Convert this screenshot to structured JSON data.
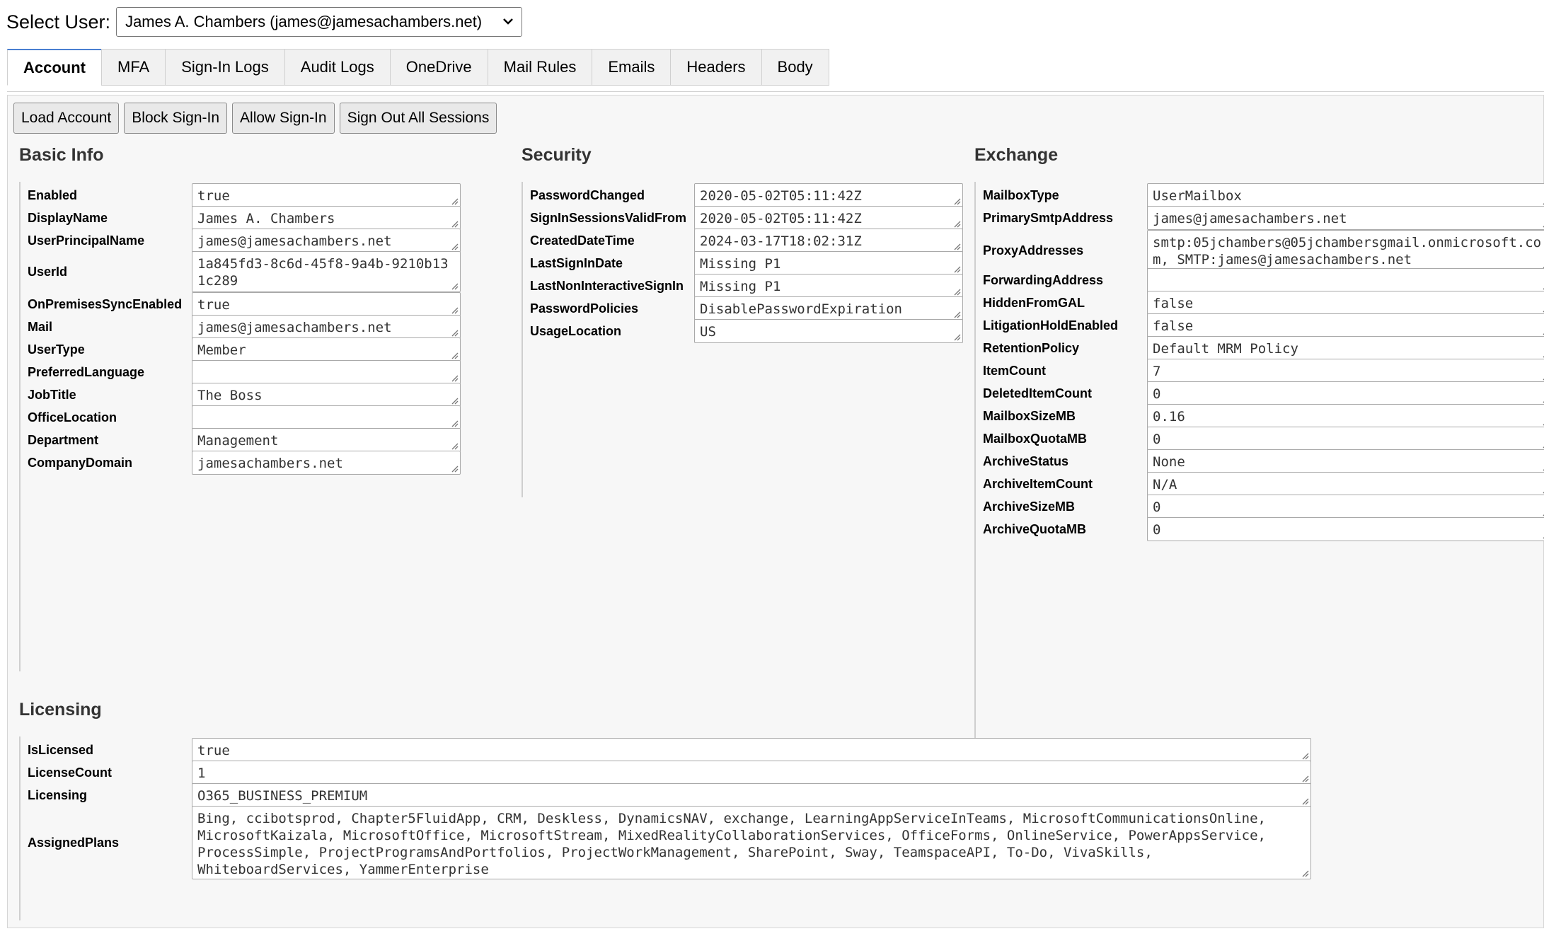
{
  "user_select": {
    "label": "Select User:",
    "selected": "James A. Chambers (james@jamesachambers.net)"
  },
  "tabs": [
    {
      "label": "Account",
      "active": true
    },
    {
      "label": "MFA"
    },
    {
      "label": "Sign-In Logs"
    },
    {
      "label": "Audit Logs"
    },
    {
      "label": "OneDrive"
    },
    {
      "label": "Mail Rules"
    },
    {
      "label": "Emails"
    },
    {
      "label": "Headers"
    },
    {
      "label": "Body"
    }
  ],
  "actions": {
    "load": "Load Account",
    "block": "Block Sign-In",
    "allow": "Allow Sign-In",
    "signout": "Sign Out All Sessions"
  },
  "basic_info": {
    "title": "Basic Info",
    "fields": [
      {
        "key": "Enabled",
        "value": "true"
      },
      {
        "key": "DisplayName",
        "value": "James A. Chambers"
      },
      {
        "key": "UserPrincipalName",
        "value": "james@jamesachambers.net"
      },
      {
        "key": "UserId",
        "value": "1a845fd3-8c6d-45f8-9a4b-9210b131c289"
      },
      {
        "key": "OnPremisesSyncEnabled",
        "value": "true"
      },
      {
        "key": "Mail",
        "value": "james@jamesachambers.net"
      },
      {
        "key": "UserType",
        "value": "Member"
      },
      {
        "key": "PreferredLanguage",
        "value": ""
      },
      {
        "key": "JobTitle",
        "value": "The Boss"
      },
      {
        "key": "OfficeLocation",
        "value": ""
      },
      {
        "key": "Department",
        "value": "Management"
      },
      {
        "key": "CompanyDomain",
        "value": "jamesachambers.net"
      }
    ]
  },
  "security": {
    "title": "Security",
    "fields": [
      {
        "key": "PasswordChanged",
        "value": "2020-05-02T05:11:42Z"
      },
      {
        "key": "SignInSessionsValidFrom",
        "value": "2020-05-02T05:11:42Z"
      },
      {
        "key": "CreatedDateTime",
        "value": "2024-03-17T18:02:31Z"
      },
      {
        "key": "LastSignInDate",
        "value": "Missing P1"
      },
      {
        "key": "LastNonInteractiveSignIn",
        "value": "Missing P1"
      },
      {
        "key": "PasswordPolicies",
        "value": "DisablePasswordExpiration"
      },
      {
        "key": "UsageLocation",
        "value": "US"
      }
    ]
  },
  "exchange": {
    "title": "Exchange",
    "fields": [
      {
        "key": "MailboxType",
        "value": "UserMailbox"
      },
      {
        "key": "PrimarySmtpAddress",
        "value": "james@jamesachambers.net"
      },
      {
        "key": "ProxyAddresses",
        "value": "smtp:05jchambers@05jchambersgmail.onmicrosoft.com, SMTP:james@jamesachambers.net"
      },
      {
        "key": "ForwardingAddress",
        "value": ""
      },
      {
        "key": "HiddenFromGAL",
        "value": "false"
      },
      {
        "key": "LitigationHoldEnabled",
        "value": "false"
      },
      {
        "key": "RetentionPolicy",
        "value": "Default MRM Policy"
      },
      {
        "key": "ItemCount",
        "value": "7"
      },
      {
        "key": "DeletedItemCount",
        "value": "0"
      },
      {
        "key": "MailboxSizeMB",
        "value": "0.16"
      },
      {
        "key": "MailboxQuotaMB",
        "value": "0"
      },
      {
        "key": "ArchiveStatus",
        "value": "None"
      },
      {
        "key": "ArchiveItemCount",
        "value": "N/A"
      },
      {
        "key": "ArchiveSizeMB",
        "value": "0"
      },
      {
        "key": "ArchiveQuotaMB",
        "value": "0"
      }
    ]
  },
  "licensing": {
    "title": "Licensing",
    "fields": [
      {
        "key": "IsLicensed",
        "value": "true"
      },
      {
        "key": "LicenseCount",
        "value": "1"
      },
      {
        "key": "Licensing",
        "value": "O365_BUSINESS_PREMIUM"
      },
      {
        "key": "AssignedPlans",
        "value": "Bing, ccibotsprod, Chapter5FluidApp, CRM, Deskless, DynamicsNAV, exchange, LearningAppServiceInTeams, MicrosoftCommunicationsOnline, MicrosoftKaizala, MicrosoftOffice, MicrosoftStream, MixedRealityCollaborationServices, OfficeForms, OnlineService, PowerAppsService, ProcessSimple, ProjectProgramsAndPortfolios, ProjectWorkManagement, SharePoint, Sway, TeamspaceAPI, To-Do, VivaSkills, WhiteboardServices, YammerEnterprise"
      }
    ]
  }
}
